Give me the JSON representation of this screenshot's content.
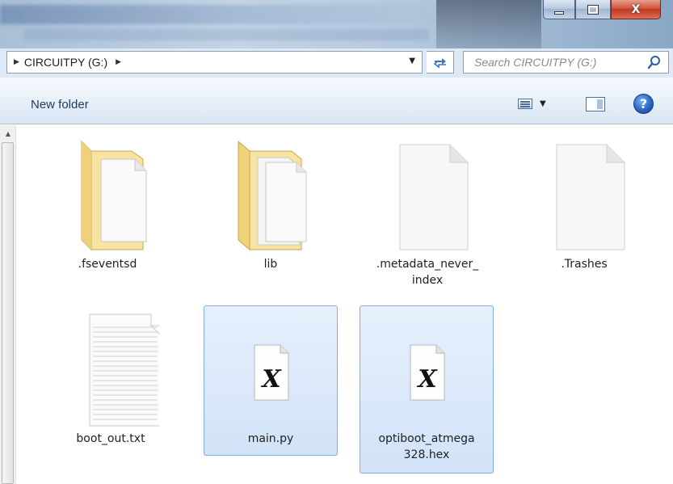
{
  "window": {
    "minimize_glyph": "",
    "close_glyph": "X"
  },
  "address_bar": {
    "path": "CIRCUITPY (G:)",
    "refresh_icon": "refresh-arrows-icon"
  },
  "search": {
    "placeholder": "Search CIRCUITPY (G:)"
  },
  "toolbar": {
    "new_folder_label": "New folder",
    "help_glyph": "?"
  },
  "files": [
    {
      "name": ".fseventsd",
      "type": "folder",
      "selected": false
    },
    {
      "name": "lib",
      "type": "folder",
      "selected": false
    },
    {
      "name": ".metadata_never_\nindex",
      "type": "blank-file",
      "selected": false
    },
    {
      "name": ".Trashes",
      "type": "blank-file",
      "selected": false
    },
    {
      "name": "boot_out.txt",
      "type": "text-file",
      "selected": false
    },
    {
      "name": "main.py",
      "type": "x-file",
      "selected": true
    },
    {
      "name": "optiboot_atmega\n328.hex",
      "type": "x-file",
      "selected": true
    }
  ],
  "colors": {
    "selection_fill": "#d2e3f8",
    "selection_border": "#84acdd",
    "folder_yellow": "#f0d27a"
  }
}
